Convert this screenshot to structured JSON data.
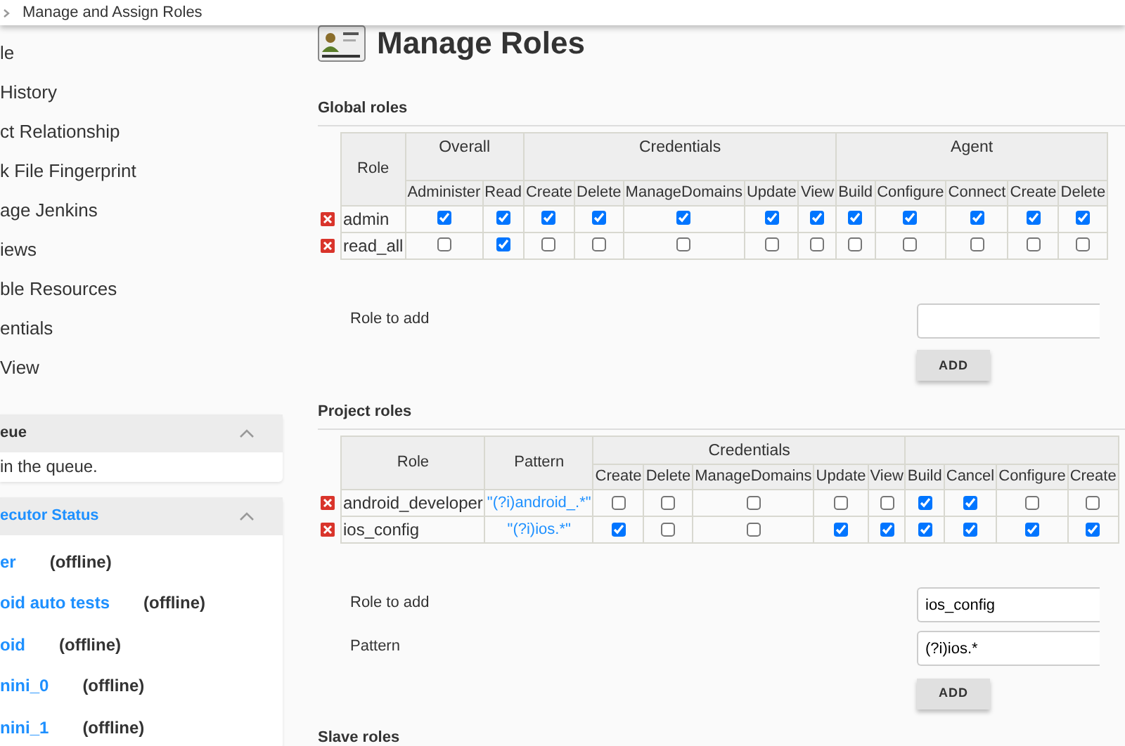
{
  "breadcrumb": {
    "label": "Manage and Assign Roles"
  },
  "sidebar": {
    "items": [
      "le",
      "History",
      "ct Relationship",
      "k File Fingerprint",
      "age Jenkins",
      "iews",
      "ble Resources",
      "entials",
      "View"
    ]
  },
  "queue_panel": {
    "title": "eue",
    "expanded": true,
    "message": "in the queue."
  },
  "executor_panel": {
    "title": "ecutor Status",
    "expanded": true,
    "nodes": [
      {
        "name": "er",
        "status": "(offline)"
      },
      {
        "name": "oid auto tests",
        "status": "(offline)"
      },
      {
        "name": "oid",
        "status": "(offline)"
      },
      {
        "name": "nini_0",
        "status": "(offline)"
      },
      {
        "name": "nini_1",
        "status": "(offline)"
      }
    ]
  },
  "page_title": "Manage Roles",
  "global_roles": {
    "heading": "Global roles",
    "role_header": "Role",
    "groups": [
      {
        "label": "Overall",
        "columns": [
          "Administer",
          "Read"
        ]
      },
      {
        "label": "Credentials",
        "columns": [
          "Create",
          "Delete",
          "ManageDomains",
          "Update",
          "View"
        ]
      },
      {
        "label": "Agent",
        "columns": [
          "Build",
          "Configure",
          "Connect",
          "Create",
          "Delete"
        ]
      }
    ],
    "rows": [
      {
        "role": "admin",
        "checks": [
          true,
          true,
          true,
          true,
          true,
          true,
          true,
          true,
          true,
          true,
          true,
          true
        ]
      },
      {
        "role": "read_all",
        "checks": [
          false,
          true,
          false,
          false,
          false,
          false,
          false,
          false,
          false,
          false,
          false,
          false
        ]
      }
    ],
    "form": {
      "role_label": "Role to add",
      "button": "ADD"
    }
  },
  "project_roles": {
    "heading": "Project roles",
    "role_header": "Role",
    "pattern_header": "Pattern",
    "groups": [
      {
        "label": "Credentials",
        "columns": [
          "Create",
          "Delete",
          "ManageDomains",
          "Update",
          "View"
        ]
      },
      {
        "columns": [
          "Build",
          "Cancel",
          "Configure",
          "Create"
        ]
      }
    ],
    "rows": [
      {
        "role": "android_developer",
        "pattern": "\"(?i)android_.*\"",
        "checks": [
          false,
          false,
          false,
          false,
          false,
          true,
          true,
          false,
          false
        ]
      },
      {
        "role": "ios_config",
        "pattern": "\"(?i)ios.*\"",
        "checks": [
          true,
          false,
          false,
          true,
          true,
          true,
          true,
          true,
          true
        ]
      }
    ],
    "form": {
      "role_label": "Role to add",
      "role_value": "ios_config",
      "pattern_label": "Pattern",
      "pattern_value": "(?i)ios.*",
      "button": "ADD"
    }
  },
  "slave_roles": {
    "heading": "Slave roles"
  }
}
